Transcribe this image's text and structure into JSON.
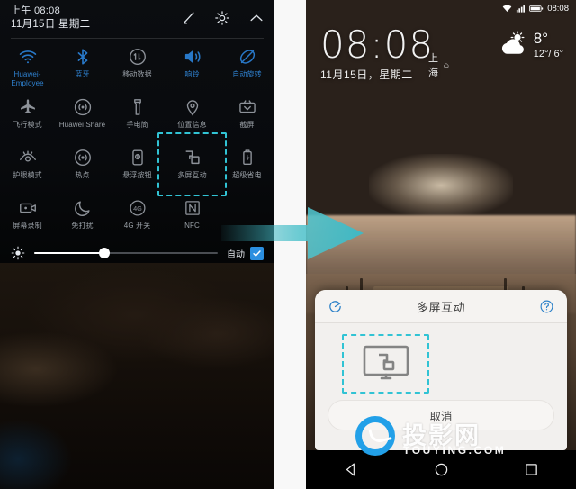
{
  "left_phone": {
    "shade": {
      "time": "上午 08:08",
      "date": "11月15日 星期二",
      "header_icons": [
        {
          "name": "edit-icon",
          "label": "编辑"
        },
        {
          "name": "settings-gear-icon",
          "label": "设置"
        },
        {
          "name": "chevron-up-icon",
          "label": "收起"
        }
      ],
      "toggles": [
        {
          "label": "Huawei-Employee",
          "icon": "wifi-icon",
          "state": "on"
        },
        {
          "label": "蓝牙",
          "icon": "bluetooth-icon",
          "state": "on"
        },
        {
          "label": "移动数据",
          "icon": "mobile-data-icon",
          "state": "off"
        },
        {
          "label": "响铃",
          "icon": "ringer-icon",
          "state": "on"
        },
        {
          "label": "自动旋转",
          "icon": "auto-rotate-icon",
          "state": "on"
        },
        {
          "label": "飞行模式",
          "icon": "airplane-icon",
          "state": "off"
        },
        {
          "label": "Huawei Share",
          "icon": "huawei-share-icon",
          "state": "off"
        },
        {
          "label": "手电筒",
          "icon": "flashlight-icon",
          "state": "off"
        },
        {
          "label": "位置信息",
          "icon": "location-pin-icon",
          "state": "off"
        },
        {
          "label": "截屏",
          "icon": "screenshot-icon",
          "state": "off"
        },
        {
          "label": "护眼模式",
          "icon": "eye-comfort-icon",
          "state": "off"
        },
        {
          "label": "热点",
          "icon": "hotspot-icon",
          "state": "off"
        },
        {
          "label": "悬浮按钮",
          "icon": "floating-dock-icon",
          "state": "off"
        },
        {
          "label": "多屏互动",
          "icon": "multi-screen-cast-icon",
          "state": "off"
        },
        {
          "label": "超级省电",
          "icon": "ultra-power-saving-icon",
          "state": "off"
        },
        {
          "label": "屏幕录制",
          "icon": "screen-record-icon",
          "state": "off"
        },
        {
          "label": "免打扰",
          "icon": "do-not-disturb-icon",
          "state": "off"
        },
        {
          "label": "4G 开关",
          "icon": "4g-toggle-icon",
          "state": "off"
        },
        {
          "label": "NFC",
          "icon": "nfc-icon",
          "state": "off"
        },
        {
          "label": "",
          "icon": "",
          "state": "empty"
        }
      ],
      "highlighted_toggle": "多屏互动",
      "brightness": {
        "value_percent": 38,
        "auto_label": "自动",
        "auto_checked": true,
        "sun_icon": "brightness-sun-icon"
      }
    }
  },
  "arrow": {
    "name": "flow-arrow",
    "color": "#3fb8c4",
    "direction": "right"
  },
  "right_phone": {
    "statusbar": {
      "icons": [
        "wifi-icon",
        "signal-bars-icon",
        "battery-icon"
      ],
      "time": "08:08"
    },
    "clock_widget": {
      "time": "08:08",
      "city": "上海",
      "city_icon": "home-icon",
      "date": "11月15日，星期二"
    },
    "weather_widget": {
      "icon": "partly-cloudy-icon",
      "temp": "8°",
      "range": "12°/ 6°"
    },
    "dialog": {
      "title": "多屏互动",
      "refresh_icon": "refresh-icon",
      "help_icon": "help-question-icon",
      "device_icon": "cast-display-icon",
      "cancel_label": "取消"
    },
    "navbar": [
      {
        "name": "nav-back",
        "icon": "triangle-back-icon"
      },
      {
        "name": "nav-home",
        "icon": "circle-home-icon"
      },
      {
        "name": "nav-recents",
        "icon": "square-recents-icon"
      }
    ]
  },
  "watermark": {
    "chinese": "投影网",
    "english": "TOUYING.COM",
    "color": "#22a0e8"
  }
}
